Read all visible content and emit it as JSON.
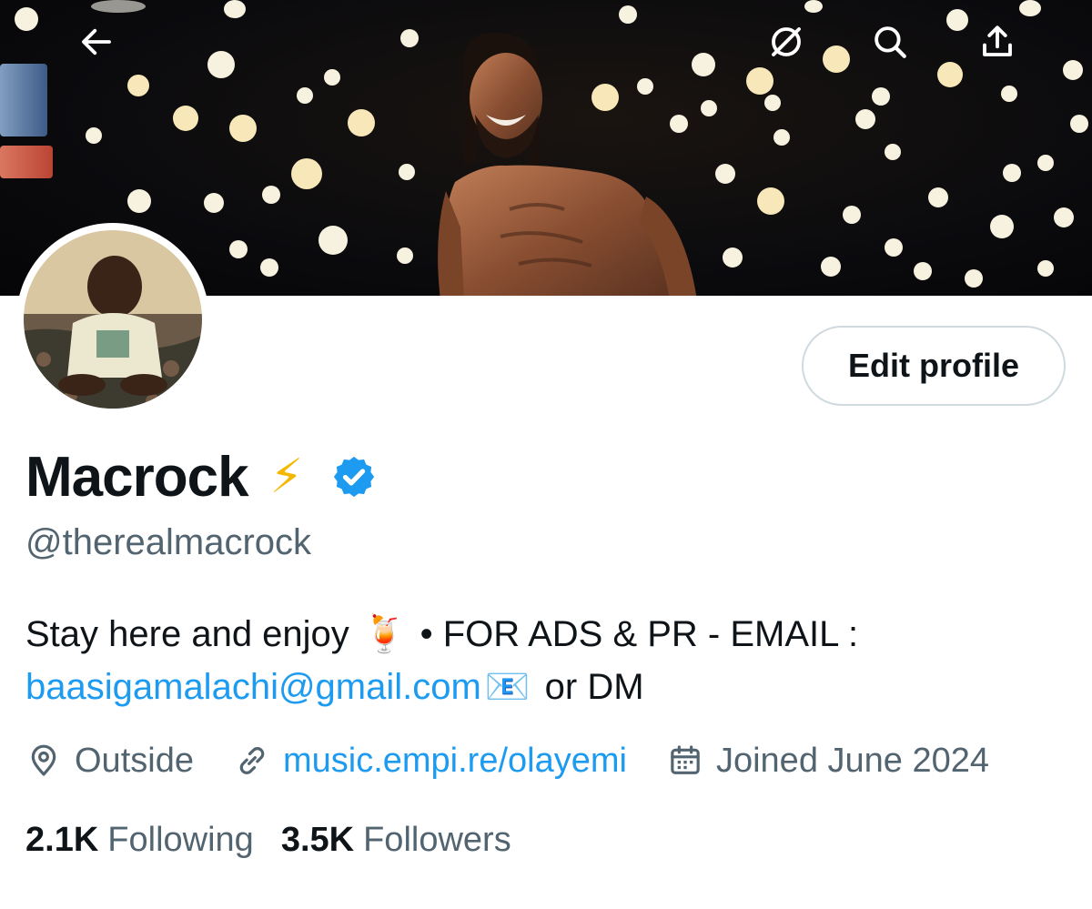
{
  "profile": {
    "display_name": "Macrock",
    "name_emoji": "⚡",
    "handle": "@therealmacrock",
    "edit_button_label": "Edit profile",
    "bio": {
      "line1_text": "Stay here and enjoy",
      "line1_emoji": "🍹",
      "line1_suffix": "• FOR ADS & PR - EMAIL :",
      "email": "baasigamalachi@gmail.com",
      "email_emoji": "📧",
      "line2_suffix": "or DM"
    },
    "location": "Outside",
    "website": "music.empi.re/olayemi",
    "joined": "Joined June 2024",
    "following_count": "2.1K",
    "following_label": "Following",
    "followers_count": "3.5K",
    "followers_label": "Followers"
  },
  "icons": {
    "back": "back-arrow-icon",
    "grok": "grok-icon",
    "search": "search-icon",
    "share": "share-icon",
    "verified": "verified-badge-icon",
    "location": "location-pin-icon",
    "link": "link-icon",
    "calendar": "calendar-icon"
  },
  "colors": {
    "accent": "#1d9bf0",
    "text_primary": "#0f1419",
    "text_secondary": "#536471",
    "border": "#cfd9de"
  }
}
